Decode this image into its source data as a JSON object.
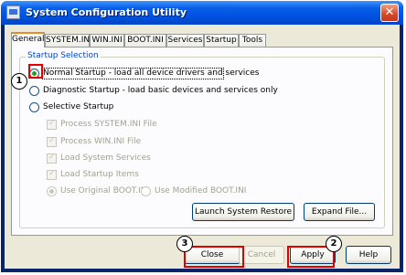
{
  "window": {
    "title": "System Configuration Utility",
    "close_glyph": "✕"
  },
  "tabs": [
    "General",
    "SYSTEM.INI",
    "WIN.INI",
    "BOOT.INI",
    "Services",
    "Startup",
    "Tools"
  ],
  "active_tab": "General",
  "startup_selection": {
    "legend": "Startup Selection",
    "normal": "Normal Startup - load all device drivers and services",
    "diagnostic": "Diagnostic Startup - load basic devices and services only",
    "selective": "Selective Startup",
    "selective_options": {
      "process_system_ini": "Process SYSTEM.INI File",
      "process_win_ini": "Process WIN.INI File",
      "load_system_services": "Load System Services",
      "load_startup_items": "Load Startup Items",
      "use_original_boot": "Use Original BOOT.INI",
      "use_modified_boot": "Use Modified BOOT.INI"
    }
  },
  "panel_buttons": {
    "launch_restore": "Launch System Restore",
    "expand_file": "Expand File..."
  },
  "footer_buttons": {
    "close": "Close",
    "cancel": "Cancel",
    "apply": "Apply",
    "help": "Help"
  },
  "callouts": {
    "one": "1",
    "two": "2",
    "three": "3"
  },
  "colors": {
    "titlebar": "#0054E3",
    "dialog": "#ECE9D8",
    "group_legend": "#0046D5",
    "annotation": "#E00000"
  }
}
